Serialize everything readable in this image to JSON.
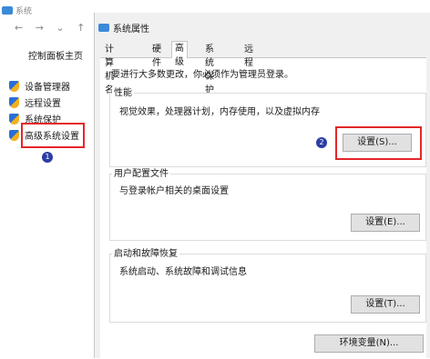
{
  "back_window": {
    "title": "系统",
    "nav_icons": [
      "back-arrow",
      "forward-arrow",
      "dropdown-chevron",
      "up-arrow"
    ],
    "nav_glyphs": [
      "←",
      "→",
      "⌄",
      "↑"
    ],
    "left_pane": {
      "home_link": "控制面板主页",
      "items": [
        {
          "label": "设备管理器",
          "icon": "shield-icon"
        },
        {
          "label": "远程设置",
          "icon": "shield-icon"
        },
        {
          "label": "系统保护",
          "icon": "shield-icon"
        },
        {
          "label": "高级系统设置",
          "icon": "shield-icon"
        }
      ]
    },
    "annotation_1": "1"
  },
  "dialog": {
    "title": "系统属性",
    "tabs": [
      {
        "label": "计算机名",
        "active": false
      },
      {
        "label": "硬件",
        "active": false
      },
      {
        "label": "高级",
        "active": true
      },
      {
        "label": "系统保护",
        "active": false
      },
      {
        "label": "远程",
        "active": false
      }
    ],
    "admin_notice": "要进行大多数更改，你必须作为管理员登录。",
    "performance": {
      "label": "性能",
      "description": "视觉效果，处理器计划，内存使用，以及虚拟内存",
      "button": "设置(S)...",
      "annotation": "2"
    },
    "user_profiles": {
      "label": "用户配置文件",
      "description": "与登录帐户相关的桌面设置",
      "button": "设置(E)..."
    },
    "startup_recovery": {
      "label": "启动和故障恢复",
      "description": "系统启动、系统故障和调试信息",
      "button": "设置(T)..."
    },
    "env_button": "环境变量(N)..."
  },
  "colors": {
    "highlight_red": "#e5262a",
    "badge_blue": "#2c3ea3",
    "dialog_bg": "#f0f0f0"
  }
}
